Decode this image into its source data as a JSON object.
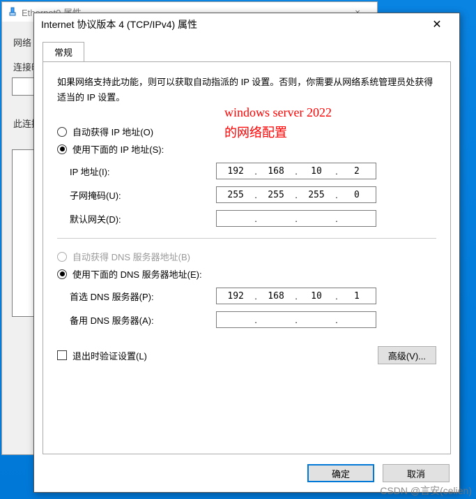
{
  "back_window": {
    "title": "Ethernet0 属性",
    "close": "×",
    "net_label": "网络",
    "connect_label": "连接时使用:",
    "section_label": "此连接使用下列项目(O):"
  },
  "dialog": {
    "title": "Internet 协议版本 4 (TCP/IPv4) 属性",
    "close": "✕",
    "tab_general": "常规",
    "description": "如果网络支持此功能，则可以获取自动指派的 IP 设置。否则，你需要从网络系统管理员处获得适当的 IP 设置。",
    "annotation_line1": "windows server 2022",
    "annotation_line2": "的网络配置",
    "radio_auto_ip": "自动获得 IP 地址(O)",
    "radio_manual_ip": "使用下面的 IP 地址(S):",
    "ip_label": "IP 地址(I):",
    "ip": [
      "192",
      "168",
      "10",
      "2"
    ],
    "mask_label": "子网掩码(U):",
    "mask": [
      "255",
      "255",
      "255",
      "0"
    ],
    "gateway_label": "默认网关(D):",
    "gateway": [
      "",
      "",
      "",
      ""
    ],
    "radio_auto_dns": "自动获得 DNS 服务器地址(B)",
    "radio_manual_dns": "使用下面的 DNS 服务器地址(E):",
    "dns1_label": "首选 DNS 服务器(P):",
    "dns1": [
      "192",
      "168",
      "10",
      "1"
    ],
    "dns2_label": "备用 DNS 服务器(A):",
    "dns2": [
      "",
      "",
      "",
      ""
    ],
    "validate_label": "退出时验证设置(L)",
    "advanced_btn": "高级(V)...",
    "ok_btn": "确定",
    "cancel_btn": "取消"
  },
  "watermark": "CSDN @言安(celien)"
}
